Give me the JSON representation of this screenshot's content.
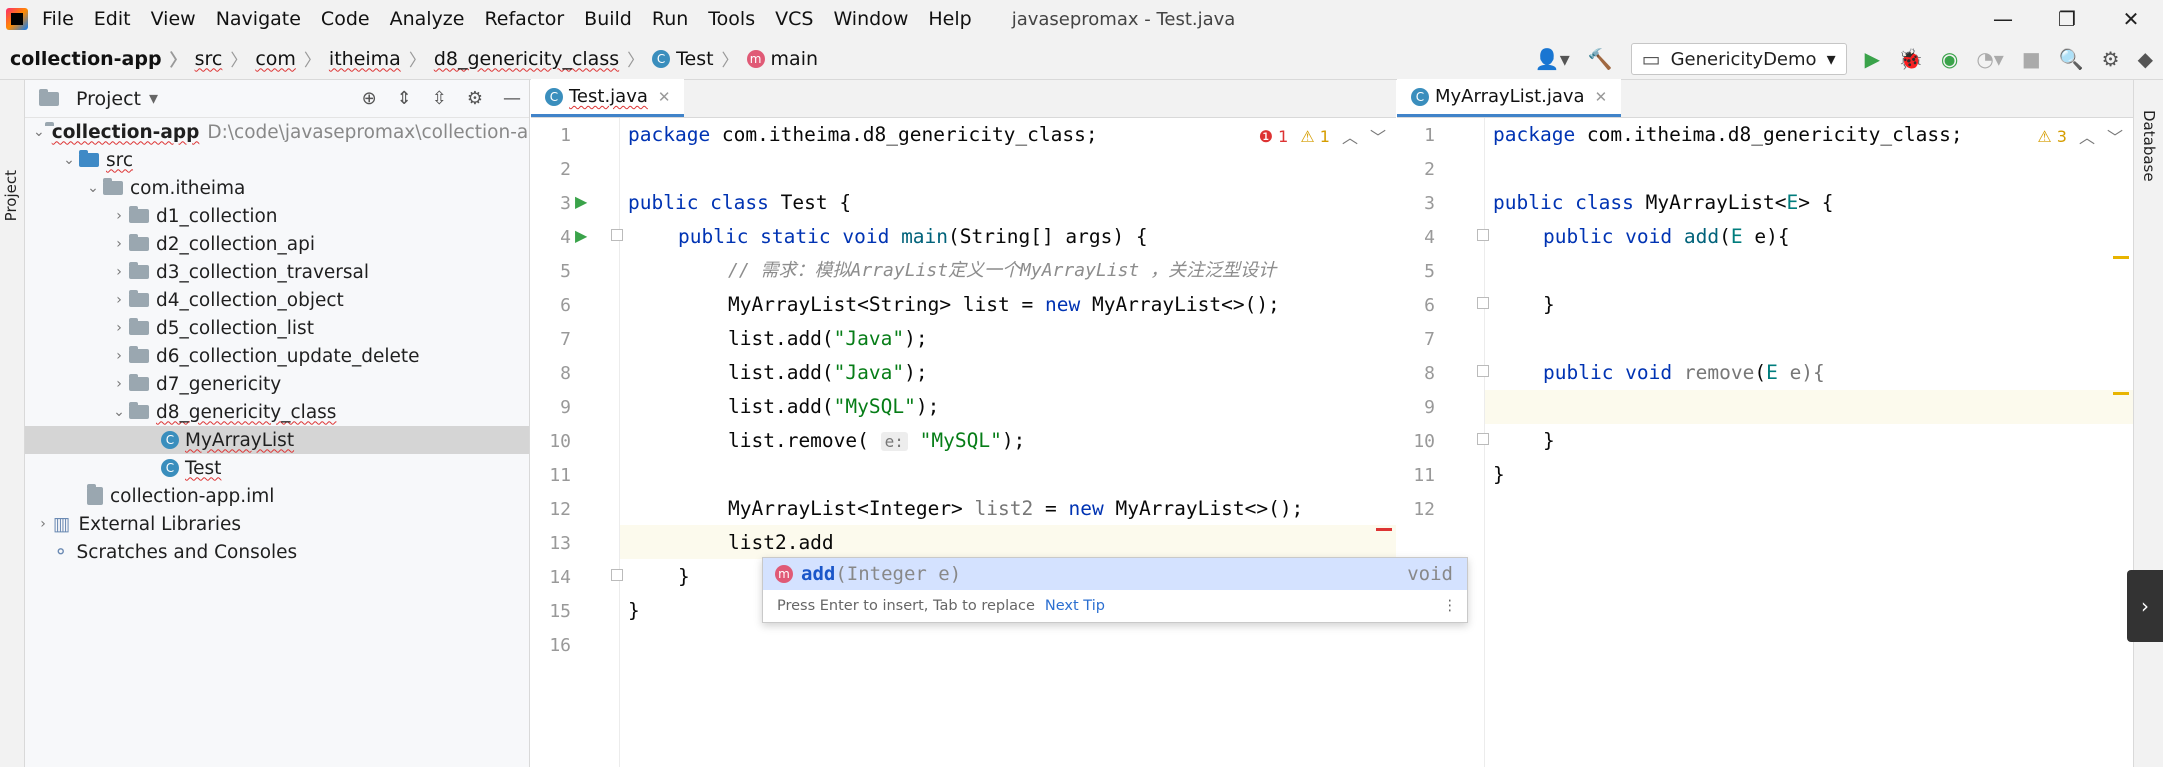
{
  "menubar": {
    "items": [
      "File",
      "Edit",
      "View",
      "Navigate",
      "Code",
      "Analyze",
      "Refactor",
      "Build",
      "Run",
      "Tools",
      "VCS",
      "Window",
      "Help"
    ],
    "title": "javasepromax - Test.java"
  },
  "navbar": {
    "crumbs": [
      "collection-app",
      "src",
      "com",
      "itheima",
      "d8_genericity_class",
      "Test",
      "main"
    ],
    "run_config": "GenericityDemo"
  },
  "left_strip": {
    "label": "Project"
  },
  "right_strip": {
    "label": "Database"
  },
  "project": {
    "title": "Project",
    "root_name": "collection-app",
    "root_path": "D:\\code\\javasepromax\\collection-app",
    "src": "src",
    "package": "com.itheima",
    "folders": [
      "d1_collection",
      "d2_collection_api",
      "d3_collection_traversal",
      "d4_collection_object",
      "d5_collection_list",
      "d6_collection_update_delete",
      "d7_genericity",
      "d8_genericity_class"
    ],
    "class_myarraylist": "MyArrayList",
    "class_test": "Test",
    "iml": "collection-app.iml",
    "external": "External Libraries",
    "scratches": "Scratches and Consoles"
  },
  "left_editor": {
    "tab": "Test.java",
    "line_numbers": [
      "1",
      "2",
      "3",
      "4",
      "5",
      "6",
      "7",
      "8",
      "9",
      "10",
      "11",
      "12",
      "13",
      "14",
      "15",
      "16"
    ],
    "errors": "1",
    "warnings": "1",
    "code": {
      "l1_kw": "package",
      "l1_rest": " com.itheima.d8_genericity_class;",
      "l3_kw": "public class",
      "l3_rest": " Test {",
      "l4_kw1": "public static void",
      "l4_fn": " main",
      "l4_rest": "(String[] args) {",
      "l5_comment": "// 需求：模拟ArrayList定义一个MyArrayList ，关注泛型设计",
      "l6_a": "MyArrayList<String> list = ",
      "l6_kw": "new",
      "l6_b": " MyArrayList<>();",
      "l7_a": "list.add(",
      "l7_str": "\"Java\"",
      "l7_b": ");",
      "l8_a": "list.add(",
      "l8_str": "\"Java\"",
      "l8_b": ");",
      "l9_a": "list.add(",
      "l9_str": "\"MySQL\"",
      "l9_b": ");",
      "l10_a": "list.remove( ",
      "l10_hint": "e:",
      "l10_str": " \"MySQL\"",
      "l10_b": ");",
      "l12_a": "MyArrayList<Integer> ",
      "l12_var": "list2",
      "l12_b": " = ",
      "l12_kw": "new",
      "l12_c": " MyArrayList<>();",
      "l13": "list2.add",
      "l14": "}",
      "l15": "}"
    }
  },
  "right_editor": {
    "tab": "MyArrayList.java",
    "line_numbers": [
      "1",
      "2",
      "3",
      "4",
      "5",
      "6",
      "7",
      "8",
      "9",
      "10",
      "11",
      "12"
    ],
    "warnings": "3",
    "code": {
      "l1_kw": "package",
      "l1_rest": " com.itheima.d8_genericity_class;",
      "l3_kw": "public class",
      "l3_rest": " MyArrayList<",
      "l3_tp": "E",
      "l3_end": "> {",
      "l4_kw": "public void",
      "l4_fn": " add",
      "l4_a": "(",
      "l4_tp": "E",
      "l4_b": " e){",
      "l6": "}",
      "l8_kw": "public void",
      "l8_fn": " remove",
      "l8_a": "(",
      "l8_tp": "E",
      "l8_b": " e){",
      "l10": "}",
      "l11": "}"
    }
  },
  "popup": {
    "method_badge": "m",
    "name": "add",
    "params": "(Integer e)",
    "return_type": "void",
    "footer": "Press Enter to insert, Tab to replace",
    "next_tip": "Next Tip"
  },
  "colors": {
    "accent": "#4083c9",
    "keyword": "#0033b3",
    "string": "#067d17",
    "selection": "#d4e2ff"
  }
}
